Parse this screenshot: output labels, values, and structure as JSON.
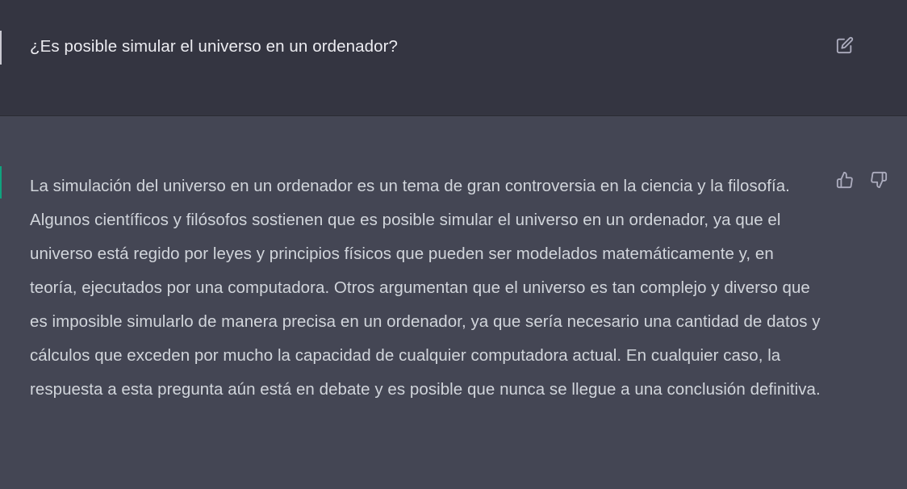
{
  "conversation": {
    "user_message": {
      "text": "¿Es posible simular el universo en un ordenador?",
      "edit_icon": "edit-icon"
    },
    "assistant_message": {
      "text": "La simulación del universo en un ordenador es un tema de gran controversia en la ciencia y la filosofía. Algunos científicos y filósofos sostienen que es posible simular el universo en un ordenador, ya que el universo está regido por leyes y principios físicos que pueden ser modelados matemáticamente y, en teoría, ejecutados por una computadora. Otros argumentan que el universo es tan complejo y diverso que es imposible simularlo de manera precisa en un ordenador, ya que sería necesario una cantidad de datos y cálculos que exceden por mucho la capacidad de cualquier computadora actual. En cualquier caso, la respuesta a esta pregunta aún está en debate y es posible que nunca se llegue a una conclusión definitiva.",
      "feedback_icons": [
        "thumbs-up-icon",
        "thumbs-down-icon"
      ]
    }
  },
  "colors": {
    "user_background": "#343541",
    "assistant_background": "#444654",
    "user_text": "#ececf1",
    "assistant_text": "#d1d5db",
    "icon": "#acacbe",
    "assistant_accent": "#10a37f"
  }
}
